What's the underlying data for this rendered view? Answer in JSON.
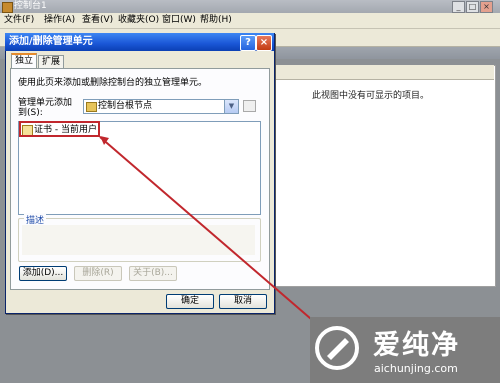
{
  "main_window": {
    "title": "控制台1",
    "controls": [
      "_",
      "□",
      "×"
    ],
    "menu": [
      "文件(F)",
      "操作(A)",
      "查看(V)",
      "收藏夹(O)",
      "窗口(W)",
      "帮助(H)"
    ],
    "empty_message": "此视图中没有可显示的项目。"
  },
  "dialog": {
    "title": "添加/删除管理单元",
    "help_glyph": "?",
    "close_glyph": "×",
    "tabs": [
      {
        "label": "独立",
        "active": true
      },
      {
        "label": "扩展",
        "active": false
      }
    ],
    "description": "使用此页来添加或删除控制台的独立管理单元。",
    "add_to_label": "管理单元添加到(S):",
    "add_to_value": "控制台根节点",
    "snapins": [
      {
        "label": "证书 - 当前用户",
        "highlighted": true
      }
    ],
    "description_group_label": "描述",
    "buttons": {
      "add": "添加(D)...",
      "remove": "删除(R)",
      "about": "关于(B)..."
    },
    "ok": "确定",
    "cancel": "取消"
  },
  "annotation": {
    "highlight_color": "#c1272d"
  },
  "watermark": {
    "cn": "爱纯净",
    "en": "aichunjing.com"
  }
}
